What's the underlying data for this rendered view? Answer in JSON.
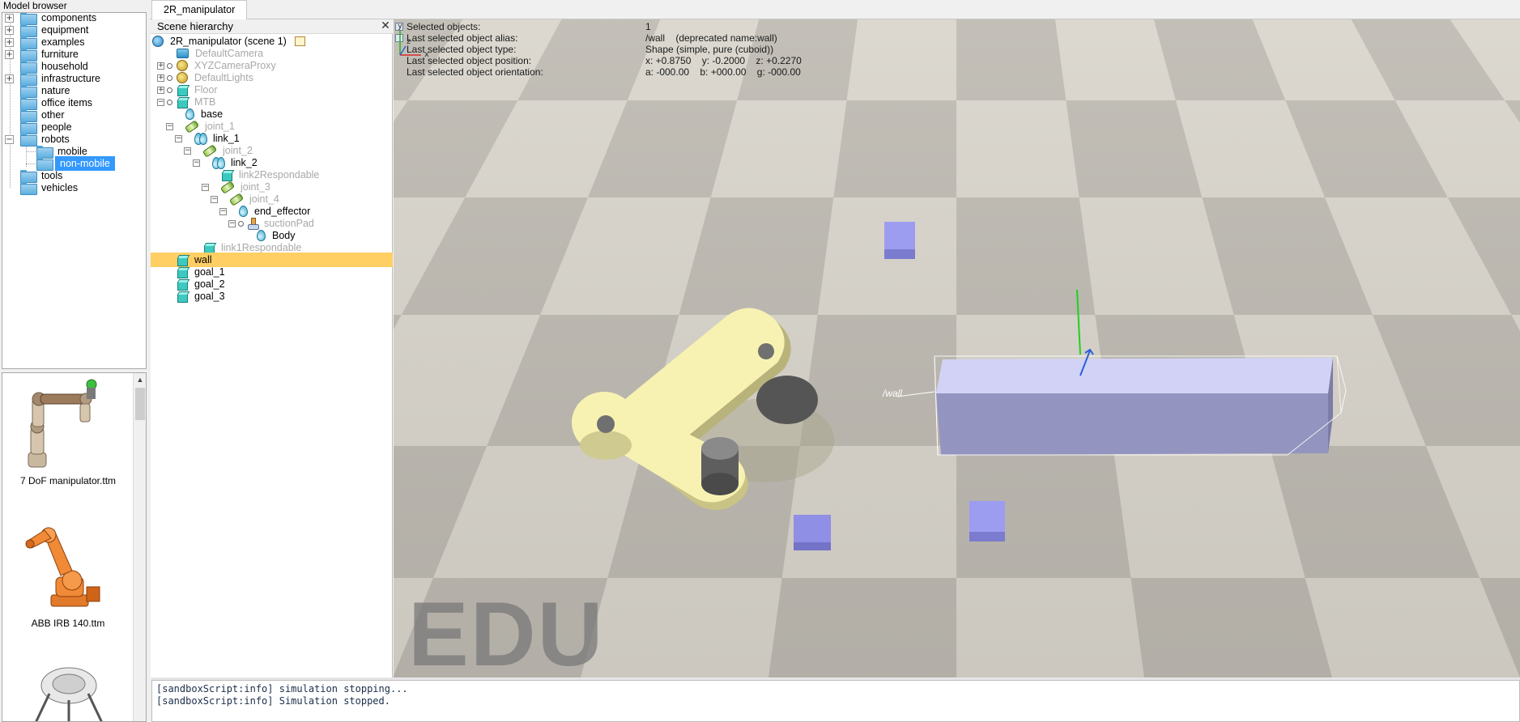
{
  "model_browser": {
    "title": "Model browser",
    "folders": [
      {
        "label": "components",
        "expandable": true
      },
      {
        "label": "equipment",
        "expandable": true
      },
      {
        "label": "examples",
        "expandable": true
      },
      {
        "label": "furniture",
        "expandable": true
      },
      {
        "label": "household",
        "expandable": false
      },
      {
        "label": "infrastructure",
        "expandable": true
      },
      {
        "label": "nature",
        "expandable": false
      },
      {
        "label": "office items",
        "expandable": false
      },
      {
        "label": "other",
        "expandable": false
      },
      {
        "label": "people",
        "expandable": false
      },
      {
        "label": "robots",
        "expandable": true,
        "expanded": true
      },
      {
        "label": "mobile",
        "child": true
      },
      {
        "label": "non-mobile",
        "child": true,
        "selected": true
      },
      {
        "label": "tools",
        "expandable": false
      },
      {
        "label": "vehicles",
        "expandable": false
      }
    ],
    "thumbnails": [
      {
        "label": "7 DoF manipulator.ttm"
      },
      {
        "label": "ABB IRB 140.ttm"
      }
    ]
  },
  "tab": {
    "label": "2R_manipulator"
  },
  "scene_hierarchy": {
    "title": "Scene hierarchy",
    "close_glyph": "✕",
    "items": [
      {
        "label": "2R_manipulator (scene 1)",
        "icon": "globe-icon"
      },
      {
        "label": "DefaultCamera",
        "icon": "camera-icon",
        "greyed": true
      },
      {
        "label": "XYZCameraProxy",
        "icon": "proxy-icon",
        "greyed": true
      },
      {
        "label": "DefaultLights",
        "icon": "proxy-icon",
        "greyed": true
      },
      {
        "label": "Floor",
        "icon": "cube-icon",
        "greyed": true
      },
      {
        "label": "MTB",
        "icon": "cube-icon",
        "greyed": true
      },
      {
        "label": "base",
        "icon": "drop-icon"
      },
      {
        "label": "joint_1",
        "icon": "joint-icon",
        "greyed": true
      },
      {
        "label": "link_1",
        "icon": "drop-pair-icon"
      },
      {
        "label": "joint_2",
        "icon": "joint-icon",
        "greyed": true
      },
      {
        "label": "link_2",
        "icon": "drop-pair-icon"
      },
      {
        "label": "link2Respondable",
        "icon": "cube-icon",
        "greyed": true
      },
      {
        "label": "joint_3",
        "icon": "joint-icon",
        "greyed": true
      },
      {
        "label": "joint_4",
        "icon": "joint-icon",
        "greyed": true
      },
      {
        "label": "end_effector",
        "icon": "drop-icon"
      },
      {
        "label": "suctionPad",
        "icon": "suction-icon",
        "greyed": true
      },
      {
        "label": "Body",
        "icon": "drop-icon"
      },
      {
        "label": "link1Respondable",
        "icon": "cube-icon",
        "greyed": true
      },
      {
        "label": "wall",
        "icon": "cube-icon",
        "highlighted": true
      },
      {
        "label": "goal_1",
        "icon": "cube-icon"
      },
      {
        "label": "goal_2",
        "icon": "cube-icon"
      },
      {
        "label": "goal_3",
        "icon": "cube-icon"
      }
    ]
  },
  "info": {
    "rows": [
      {
        "label": "Selected objects:",
        "value": "1"
      },
      {
        "label": "Last selected object alias:",
        "value": "/wall    (deprecated name:wall)"
      },
      {
        "label": "Last selected object type:",
        "value": "Shape (simple, pure (cuboid))"
      },
      {
        "label": "Last selected object position:",
        "value": "x: +0.8750    y: -0.2000    z: +0.2270"
      },
      {
        "label": "Last selected object orientation:",
        "value": "a: -000.00    b: +000.00    g: -000.00"
      }
    ]
  },
  "viewport": {
    "watermark": "EDU",
    "wall_tag": "/wall",
    "axes": {
      "x": "x",
      "y": "y",
      "z": "z"
    },
    "colors": {
      "floor_light": "#d9d5cc",
      "floor_dark": "#b9b5ad",
      "arm": "#f5f0b0",
      "goal": "#8f8fe6",
      "wall_top": "#c8c8f0",
      "wall_side": "#8e8eb8"
    }
  },
  "console": {
    "lines": [
      "[sandboxScript:info] simulation stopping...",
      "[sandboxScript:info] Simulation stopped."
    ]
  }
}
